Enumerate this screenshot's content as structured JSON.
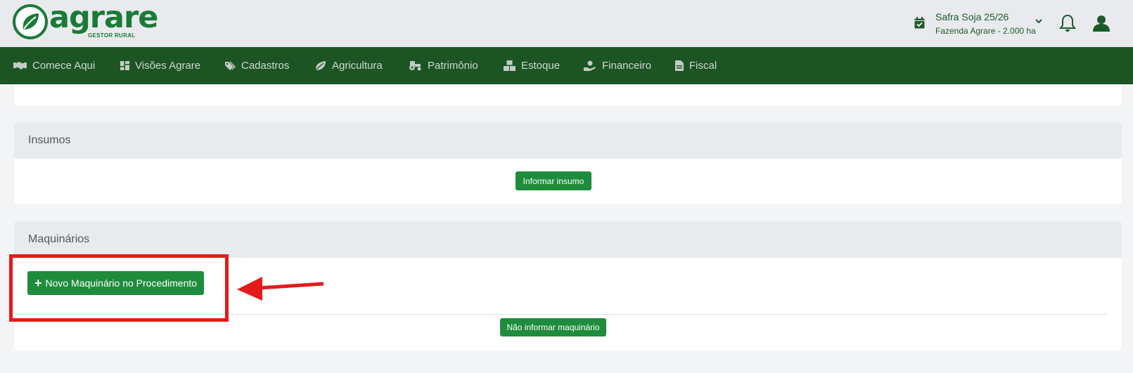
{
  "brand": {
    "name": "agrare",
    "tagline": "GESTOR RURAL",
    "color": "#1a7a37"
  },
  "header": {
    "season": "Safra Soja 25/26",
    "farm": "Fazenda Agrare - 2.000 ha",
    "icons": [
      "calendar-check-icon",
      "chevron-down-icon",
      "bell-icon",
      "user-icon"
    ]
  },
  "nav": {
    "items": [
      {
        "label": "Comece Aqui",
        "icon": "handshake-icon"
      },
      {
        "label": "Visões Agrare",
        "icon": "dashboard-icon"
      },
      {
        "label": "Cadastros",
        "icon": "tags-icon"
      },
      {
        "label": "Agricultura",
        "icon": "leaf-icon"
      },
      {
        "label": "Patrimônio",
        "icon": "tractor-icon"
      },
      {
        "label": "Estoque",
        "icon": "boxes-icon"
      },
      {
        "label": "Financeiro",
        "icon": "hand-holding-dollar-icon"
      },
      {
        "label": "Fiscal",
        "icon": "file-invoice-icon"
      }
    ]
  },
  "insumos": {
    "title": "Insumos",
    "button": "Informar insumo"
  },
  "maquinarios": {
    "title": "Maquinários",
    "new_button": "Novo Maquinário no Procedimento",
    "skip_button": "Não informar maquinário"
  },
  "colors": {
    "primary": "#1e8c3c",
    "nav_bg": "#1c5424",
    "header_bg": "#e9eaee",
    "annotation": "#e31b1b"
  }
}
